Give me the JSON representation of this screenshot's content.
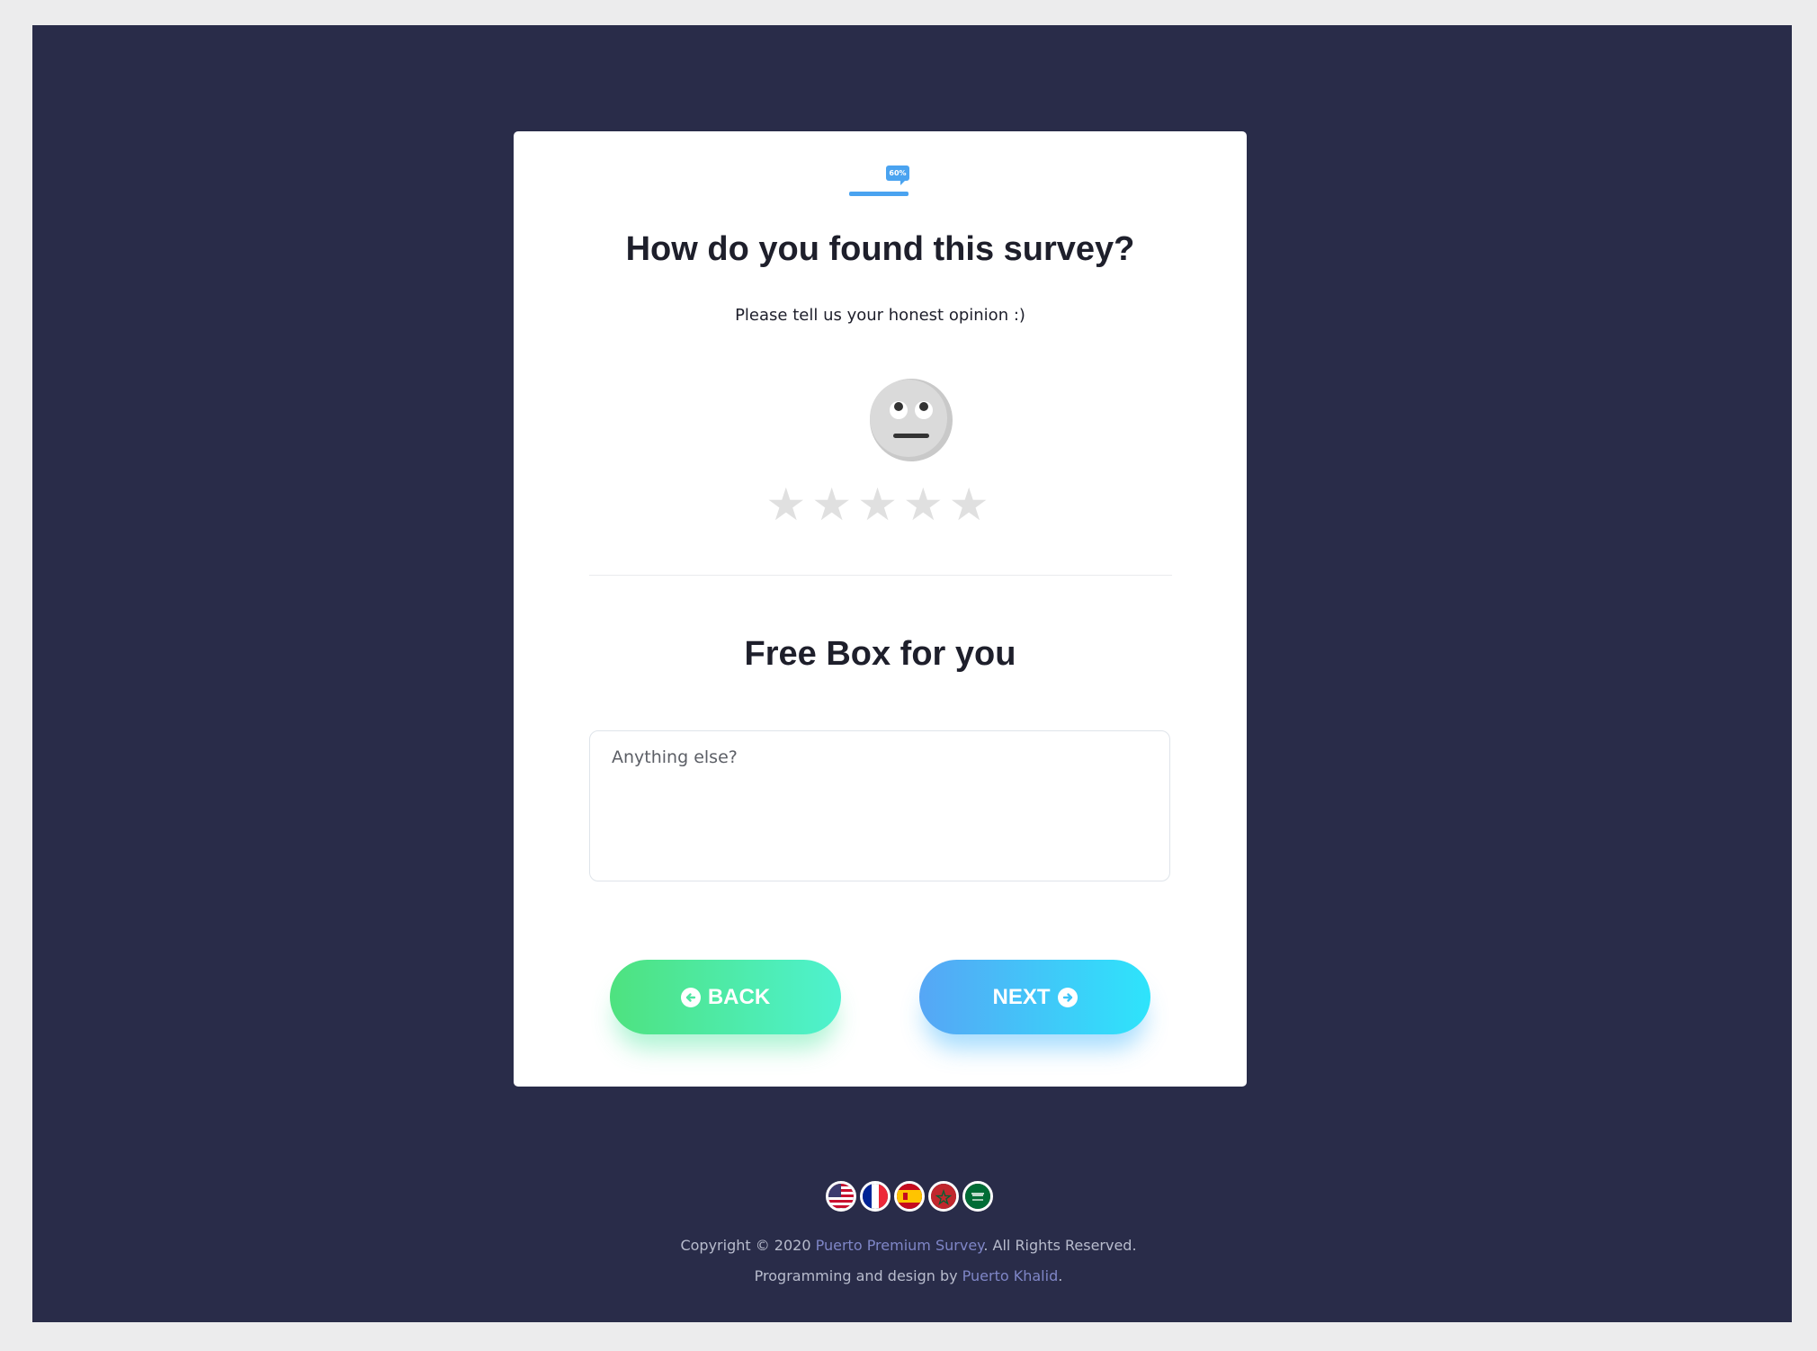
{
  "progress": {
    "label": "60%",
    "percent": 60
  },
  "question": {
    "title": "How do you found this survey?",
    "subtitle": "Please tell us your honest opinion :)"
  },
  "rating": {
    "max": 5,
    "value": 0,
    "emoji": "neutral-face-icon"
  },
  "freebox": {
    "title": "Free Box for you",
    "placeholder": "Anything else?",
    "value": ""
  },
  "buttons": {
    "back": "BACK",
    "next": "NEXT"
  },
  "languages": [
    {
      "name": "us-flag-icon"
    },
    {
      "name": "fr-flag-icon"
    },
    {
      "name": "es-flag-icon"
    },
    {
      "name": "ma-flag-icon"
    },
    {
      "name": "sa-flag-icon"
    }
  ],
  "footer": {
    "copyright_prefix": "Copyright © 2020 ",
    "brand_link": "Puerto Premium Survey",
    "copyright_suffix": ". All Rights Reserved.",
    "credit_prefix": "Programming and design by ",
    "author_link": "Puerto Khalid",
    "credit_suffix": "."
  },
  "colors": {
    "page_bg": "#292c49",
    "accent_blue": "#4aa3f0",
    "back_gradient": [
      "#4ee27f",
      "#4ef2cf"
    ],
    "next_gradient": [
      "#56a6f5",
      "#2ee4fb"
    ],
    "link": "#7f86c7"
  }
}
